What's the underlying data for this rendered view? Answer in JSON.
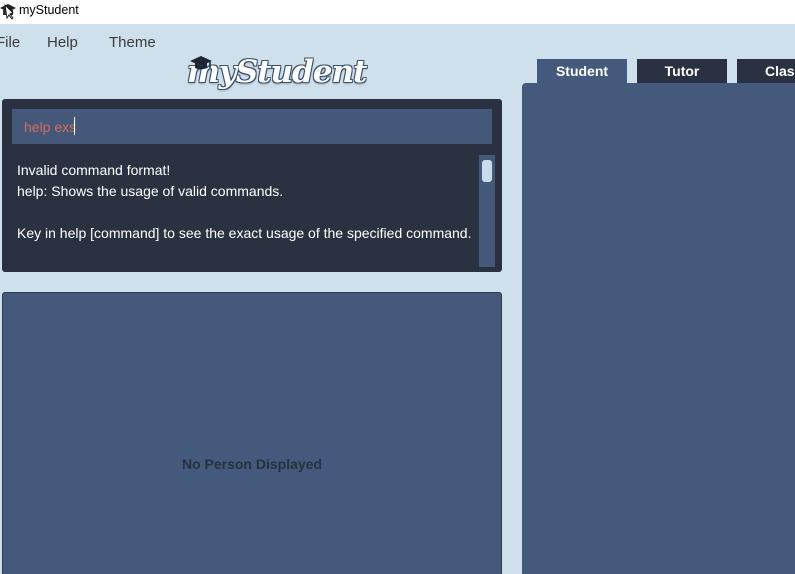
{
  "window": {
    "title": "myStudent"
  },
  "menu": {
    "file": "File",
    "help": "Help",
    "theme": "Theme"
  },
  "logo": {
    "text": "myStudent"
  },
  "command_box": {
    "input_value": "help exs",
    "result_text": "Invalid command format! \nhelp: Shows the usage of valid commands.\n\nKey in help [command] to see the exact usage of the specified command."
  },
  "person_list": {
    "empty_message": "No Person Displayed"
  },
  "tabs": [
    {
      "label": "Student"
    },
    {
      "label": "Tutor"
    },
    {
      "label": "Class"
    }
  ],
  "colors": {
    "background": "#cde0ec",
    "panel_dark": "#2a3140",
    "panel_blue": "#445a7d",
    "input_text": "#d86a59"
  }
}
